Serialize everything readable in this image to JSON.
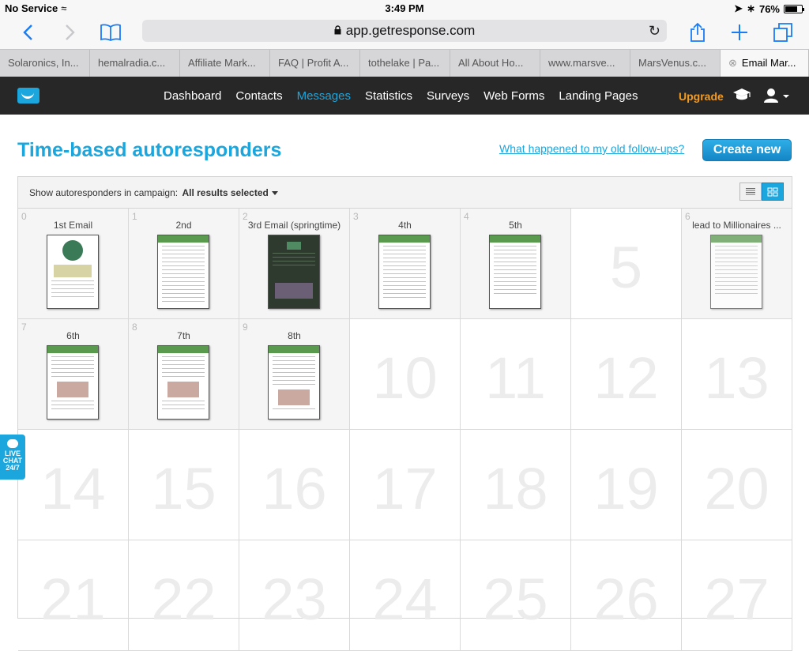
{
  "status": {
    "carrier": "No Service",
    "time": "3:49 PM",
    "battery": "76%",
    "battery_level": 0.76
  },
  "browser": {
    "url": "app.getresponse.com",
    "tabs": [
      "Solaronics, In...",
      "hemalradia.c...",
      "Affiliate Mark...",
      "FAQ | Profit A...",
      "tothelake | Pa...",
      "All About Ho...",
      "www.marsve...",
      "MarsVenus.c...",
      "Email Mar..."
    ]
  },
  "nav": {
    "items": [
      "Dashboard",
      "Contacts",
      "Messages",
      "Statistics",
      "Surveys",
      "Web Forms",
      "Landing Pages"
    ],
    "active_index": 2,
    "upgrade": "Upgrade"
  },
  "page": {
    "title": "Time-based autoresponders",
    "followups_link": "What happened to my old follow-ups?",
    "create_button": "Create new",
    "filter_label": "Show autoresponders in campaign:",
    "filter_value": "All results selected"
  },
  "days": [
    {
      "n": "0",
      "name": "1st Email"
    },
    {
      "n": "1",
      "name": "2nd"
    },
    {
      "n": "2",
      "name": "3rd Email (springtime)"
    },
    {
      "n": "3",
      "name": "4th"
    },
    {
      "n": "4",
      "name": "5th"
    },
    {
      "n": "5",
      "name": ""
    },
    {
      "n": "6",
      "name": "lead to Millionaires ..."
    },
    {
      "n": "7",
      "name": "6th"
    },
    {
      "n": "8",
      "name": "7th"
    },
    {
      "n": "9",
      "name": "8th"
    },
    {
      "n": "10",
      "name": ""
    },
    {
      "n": "11",
      "name": ""
    },
    {
      "n": "12",
      "name": ""
    },
    {
      "n": "13",
      "name": ""
    },
    {
      "n": "14",
      "name": ""
    },
    {
      "n": "15",
      "name": ""
    },
    {
      "n": "16",
      "name": ""
    },
    {
      "n": "17",
      "name": ""
    },
    {
      "n": "18",
      "name": ""
    },
    {
      "n": "19",
      "name": ""
    },
    {
      "n": "20",
      "name": ""
    },
    {
      "n": "21",
      "name": ""
    },
    {
      "n": "22",
      "name": ""
    },
    {
      "n": "23",
      "name": ""
    },
    {
      "n": "24",
      "name": ""
    },
    {
      "n": "25",
      "name": ""
    },
    {
      "n": "26",
      "name": ""
    },
    {
      "n": "27",
      "name": ""
    }
  ],
  "live_chat": {
    "line1": "LIVE",
    "line2": "CHAT",
    "line3": "24/7"
  },
  "colors": {
    "accent": "#1ba6dd",
    "upgrade": "#f39c1f",
    "navbar": "#272727"
  }
}
